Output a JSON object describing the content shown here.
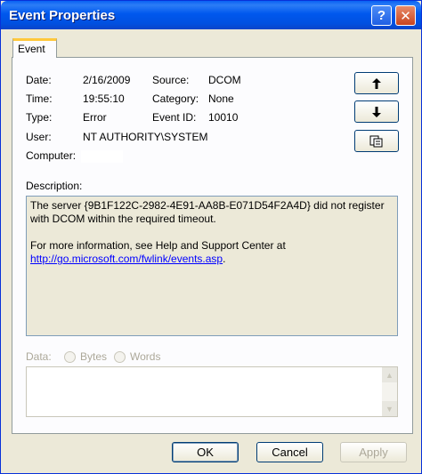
{
  "window": {
    "title": "Event Properties"
  },
  "titlebar": {
    "help_label": "?",
    "close_label": "✕"
  },
  "tabs": [
    {
      "label": "Event"
    }
  ],
  "fields": {
    "date_label": "Date:",
    "date_value": "2/16/2009",
    "time_label": "Time:",
    "time_value": "19:55:10",
    "type_label": "Type:",
    "type_value": "Error",
    "user_label": "User:",
    "user_value": "NT AUTHORITY\\SYSTEM",
    "computer_label": "Computer:",
    "source_label": "Source:",
    "source_value": "DCOM",
    "category_label": "Category:",
    "category_value": "None",
    "eventid_label": "Event ID:",
    "eventid_value": "10010"
  },
  "side_buttons": {
    "up_icon": "up-arrow-icon",
    "down_icon": "down-arrow-icon",
    "copy_icon": "copy-icon"
  },
  "description": {
    "label": "Description:",
    "line1": "The server {9B1F122C-2982-4E91-AA8B-E071D54F2A4D} did not register with DCOM within the required timeout.",
    "line2_prefix": "For more information, see Help and Support Center at",
    "link": "http://go.microsoft.com/fwlink/events.asp",
    "link_suffix": "."
  },
  "data_section": {
    "label": "Data:",
    "bytes_label": "Bytes",
    "words_label": "Words"
  },
  "buttons": {
    "ok": "OK",
    "cancel": "Cancel",
    "apply": "Apply"
  }
}
